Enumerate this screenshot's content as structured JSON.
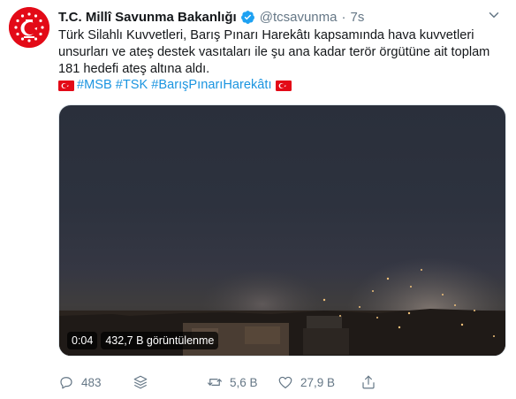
{
  "account": {
    "name": "T.C. Millî Savunma Bakanlığı",
    "handle": "@tcsavunma",
    "separator": "·",
    "time": "7s",
    "verified": true
  },
  "tweet": {
    "text_line1": "Türk Silahlı Kuvvetleri, Barış Pınarı Harekâtı kapsamında hava kuvvetleri",
    "text_line2": "unsurları ve ateş destek vasıtaları ile şu ana kadar terör örgütüne ait toplam",
    "text_line3": "181 hedefi ateş altına aldı.",
    "hashtags": [
      "#MSB",
      "#TSK",
      "#BarışPınarıHarekâtı"
    ]
  },
  "video": {
    "duration": "0:04",
    "views": "432,7 B görüntülenme"
  },
  "actions": {
    "reply_count": "483",
    "retweet_count": "5,6 B",
    "like_count": "27,9 B"
  },
  "colors": {
    "accent": "#1b95e0",
    "muted": "#657786",
    "flag_red": "#e30a17",
    "verified_blue": "#1da1f2"
  }
}
